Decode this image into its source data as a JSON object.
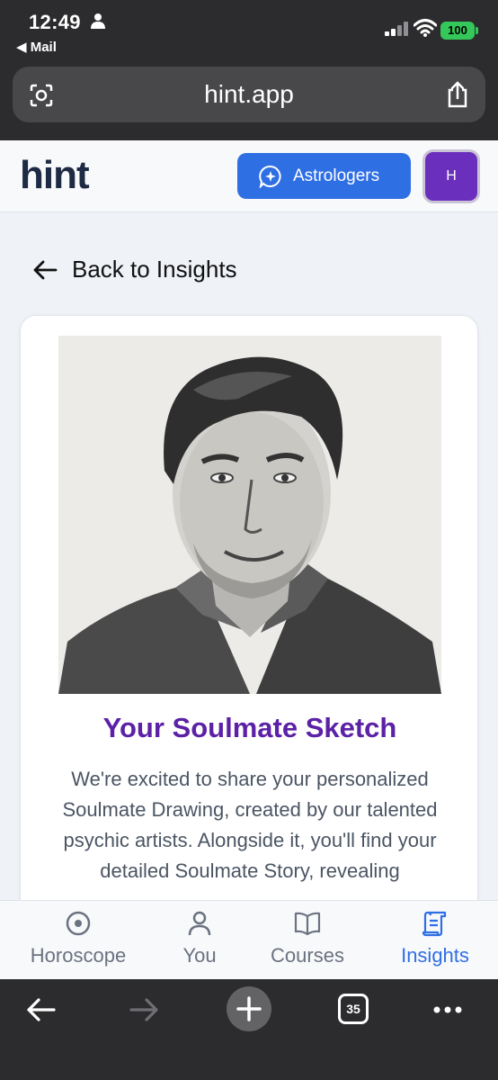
{
  "status_bar": {
    "time": "12:49",
    "back_app": "◀ Mail",
    "battery": "100"
  },
  "browser": {
    "url": "hint.app",
    "tab_count": "35"
  },
  "header": {
    "logo": "hint",
    "astrologers_label": "Astrologers",
    "avatar_initial": "H"
  },
  "back_link": "Back to Insights",
  "card": {
    "title": "Your Soulmate Sketch",
    "body": "We're excited to share your personalized Soulmate Drawing, created by our talented psychic artists. Alongside it, you'll find your detailed Soulmate Story, revealing"
  },
  "nav": {
    "items": [
      {
        "label": "Horoscope",
        "icon": "horoscope-icon"
      },
      {
        "label": "You",
        "icon": "user-icon"
      },
      {
        "label": "Courses",
        "icon": "book-icon"
      },
      {
        "label": "Insights",
        "icon": "scroll-icon",
        "active": true
      }
    ]
  },
  "colors": {
    "brand_blue": "#2f6fe4",
    "title_purple": "#5b21a6",
    "avatar_purple": "#6b2fbd"
  }
}
